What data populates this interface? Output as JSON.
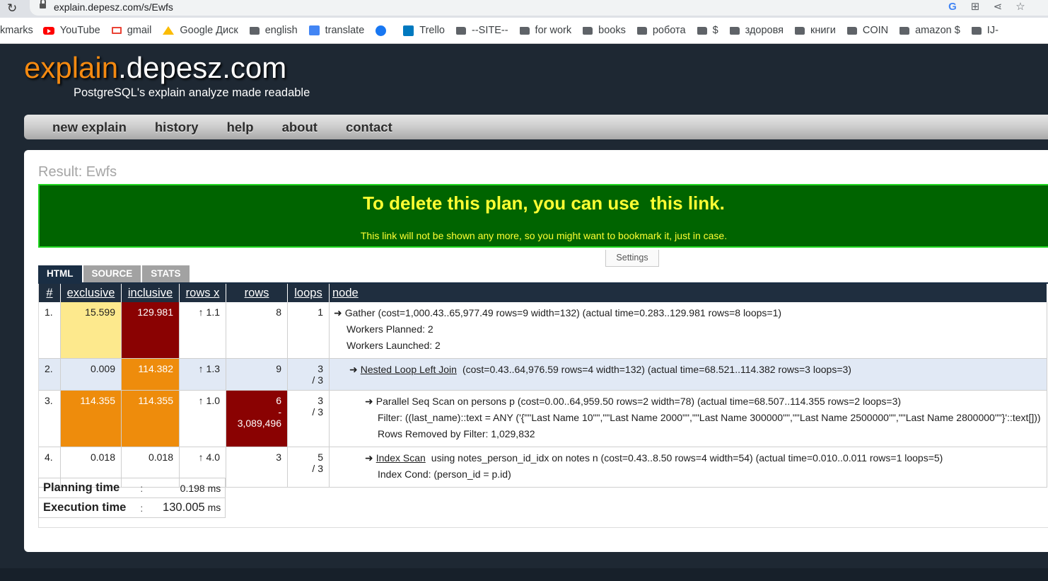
{
  "browser": {
    "url": "explain.depesz.com/s/Ewfs"
  },
  "bookmarks": [
    {
      "label": "kmarks",
      "icon": "none"
    },
    {
      "label": "YouTube",
      "icon": "youtube-icon"
    },
    {
      "label": "gmail",
      "icon": "gmail-icon"
    },
    {
      "label": "Google Диск",
      "icon": "google-drive-icon"
    },
    {
      "label": "english",
      "icon": "folder-icon"
    },
    {
      "label": "translate",
      "icon": "translate-icon"
    },
    {
      "label": "",
      "icon": "facebook-icon"
    },
    {
      "label": "Trello",
      "icon": "trello-icon"
    },
    {
      "label": "--SITE--",
      "icon": "folder-icon"
    },
    {
      "label": "for work",
      "icon": "folder-icon"
    },
    {
      "label": "books",
      "icon": "folder-icon"
    },
    {
      "label": "робота",
      "icon": "folder-icon"
    },
    {
      "label": "$",
      "icon": "folder-icon"
    },
    {
      "label": "здоровя",
      "icon": "folder-icon"
    },
    {
      "label": "книги",
      "icon": "folder-icon"
    },
    {
      "label": "COIN",
      "icon": "folder-icon"
    },
    {
      "label": "amazon $",
      "icon": "folder-icon"
    },
    {
      "label": "IJ-",
      "icon": "folder-icon"
    }
  ],
  "site": {
    "logo_part1": "explain",
    "logo_part2": ".depesz.com",
    "tagline": "PostgreSQL's explain analyze made readable",
    "accent_color": "#f58a11"
  },
  "nav": [
    "new explain",
    "history",
    "help",
    "about",
    "contact"
  ],
  "result_title": "Result: Ewfs",
  "banner": {
    "text": "To delete this plan, you can use",
    "link": "this link",
    "suffix": ".",
    "note": "This link will not be shown any more, so you might want to bookmark it, just in case."
  },
  "settings_label": "Settings",
  "tabs": [
    "HTML",
    "SOURCE",
    "STATS"
  ],
  "columns": [
    "#",
    "exclusive",
    "inclusive",
    "rows x",
    "rows",
    "loops",
    "node"
  ],
  "rows": [
    {
      "idx": "1.",
      "exclusive": "15.599",
      "inclusive": "129.981",
      "rows_x": "↑ 1.1",
      "rows": "8",
      "rows_sub": "",
      "loops": "1",
      "loops_sub": "",
      "node_title": "Gather",
      "node_title_link": false,
      "node_detail": "(cost=1,000.43..65,977.49 rows=9 width=132) (actual time=0.283..129.981 rows=8 loops=1)",
      "extra": [
        "Workers Planned: 2",
        "Workers Launched: 2"
      ]
    },
    {
      "idx": "2.",
      "exclusive": "0.009",
      "inclusive": "114.382",
      "rows_x": "↑ 1.3",
      "rows": "9",
      "rows_sub": "",
      "loops": "3",
      "loops_sub": "/ 3",
      "node_title": "Nested Loop Left Join",
      "node_title_link": true,
      "node_detail": "(cost=0.43..64,976.59 rows=4 width=132) (actual time=68.521..114.382 rows=3 loops=3)",
      "extra": []
    },
    {
      "idx": "3.",
      "exclusive": "114.355",
      "inclusive": "114.355",
      "rows_x": "↑ 1.0",
      "rows": "6",
      "rows_sub": "- 3,089,496",
      "loops": "3",
      "loops_sub": "/ 3",
      "node_title": "Parallel Seq Scan on persons p",
      "node_title_link": false,
      "node_detail": "(cost=0.00..64,959.50 rows=2 width=78) (actual time=68.507..114.355 rows=2 loops=3)",
      "extra": [
        "Filter: ((last_name)::text = ANY ('{\"\"Last Name 10\"\",\"\"Last Name 2000\"\",\"\"Last Name 300000\"\",\"\"Last Name 2500000\"\",\"\"Last Name 2800000\"\"}'::text[]))",
        "Rows Removed by Filter: 1,029,832"
      ]
    },
    {
      "idx": "4.",
      "exclusive": "0.018",
      "inclusive": "0.018",
      "rows_x": "↑ 4.0",
      "rows": "3",
      "rows_sub": "",
      "loops": "5",
      "loops_sub": "/ 3",
      "node_title": "Index Scan",
      "node_title_link": true,
      "node_detail": "using notes_person_id_idx on notes n (cost=0.43..8.50 rows=4 width=54) (actual time=0.010..0.011 rows=1 loops=5)",
      "extra": [
        "Index Cond: (person_id = p.id)"
      ]
    }
  ],
  "arrow_glyph": "➜",
  "planning": {
    "label": "Planning time",
    "sep": ":",
    "value": "0.198 ms"
  },
  "execution": {
    "label": "Execution time",
    "sep": ":",
    "value": "130.005",
    "unit": "ms"
  }
}
